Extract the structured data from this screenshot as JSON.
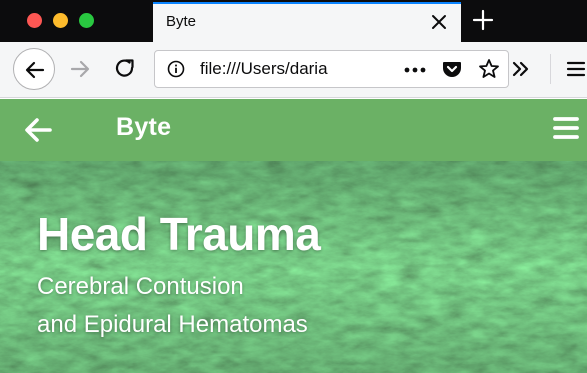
{
  "browser": {
    "tab": {
      "title": "Byte"
    },
    "url": "file:///Users/daria",
    "icons": {
      "window_close": "close-traffic-light",
      "window_minimize": "minimize-traffic-light",
      "window_zoom": "zoom-traffic-light",
      "tab_close": "close-icon",
      "new_tab": "plus-icon",
      "back": "arrow-left-icon",
      "forward": "arrow-right-icon",
      "reload": "reload-icon",
      "site_info": "info-icon",
      "page_actions": "ellipsis-icon",
      "pocket": "pocket-icon",
      "bookmark": "star-icon",
      "overflow": "chevron-double-right-icon",
      "menu": "hamburger-icon"
    },
    "colors": {
      "tab_accent": "#0a84ff",
      "traffic_close": "#fd5753",
      "traffic_minimize": "#fdbb2c",
      "traffic_zoom": "#29c840"
    }
  },
  "page": {
    "header": {
      "title": "Byte",
      "back_icon": "arrow-left-icon",
      "menu_icon": "hamburger-icon",
      "color": "#6bb165"
    },
    "hero": {
      "title": "Head Trauma",
      "subtitle_line1": "Cerebral Contusion",
      "subtitle_line2": "and Epidural Hematomas"
    }
  }
}
